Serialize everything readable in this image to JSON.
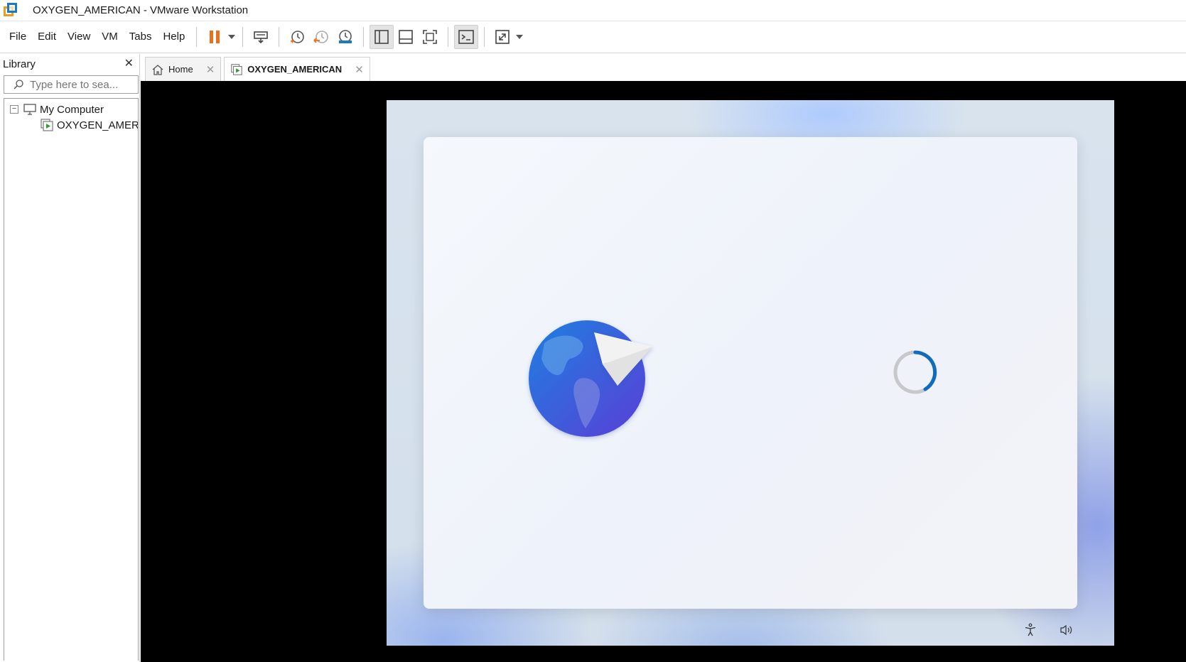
{
  "window": {
    "title": "OXYGEN_AMERICAN - VMware Workstation"
  },
  "menu": {
    "items": [
      "File",
      "Edit",
      "View",
      "VM",
      "Tabs",
      "Help"
    ]
  },
  "toolbar": {
    "icons": [
      "pause-icon",
      "send-ctrl-alt-del-icon",
      "snapshot-take-icon",
      "snapshot-revert-icon",
      "snapshot-manager-icon",
      "show-library-icon",
      "show-thumbnail-bar-icon",
      "full-screen-icon",
      "console-view-icon",
      "stretch-guest-icon"
    ],
    "accent": "#e8701f"
  },
  "library": {
    "title": "Library",
    "close": "✕",
    "search_placeholder": "Type here to sea...",
    "tree": {
      "root": "My Computer",
      "root_toggle": "−",
      "children": [
        "OXYGEN_AMERIC"
      ]
    }
  },
  "tabs": [
    {
      "label": "Home",
      "close": "✕",
      "active": false
    },
    {
      "label": "OXYGEN_AMERICAN",
      "close": "✕",
      "active": true
    }
  ],
  "guest": {
    "screen": "Windows setup (OOBE) loading",
    "icons": [
      "accessibility-icon",
      "volume-icon"
    ],
    "spinner_color": "#0f6cbd"
  }
}
